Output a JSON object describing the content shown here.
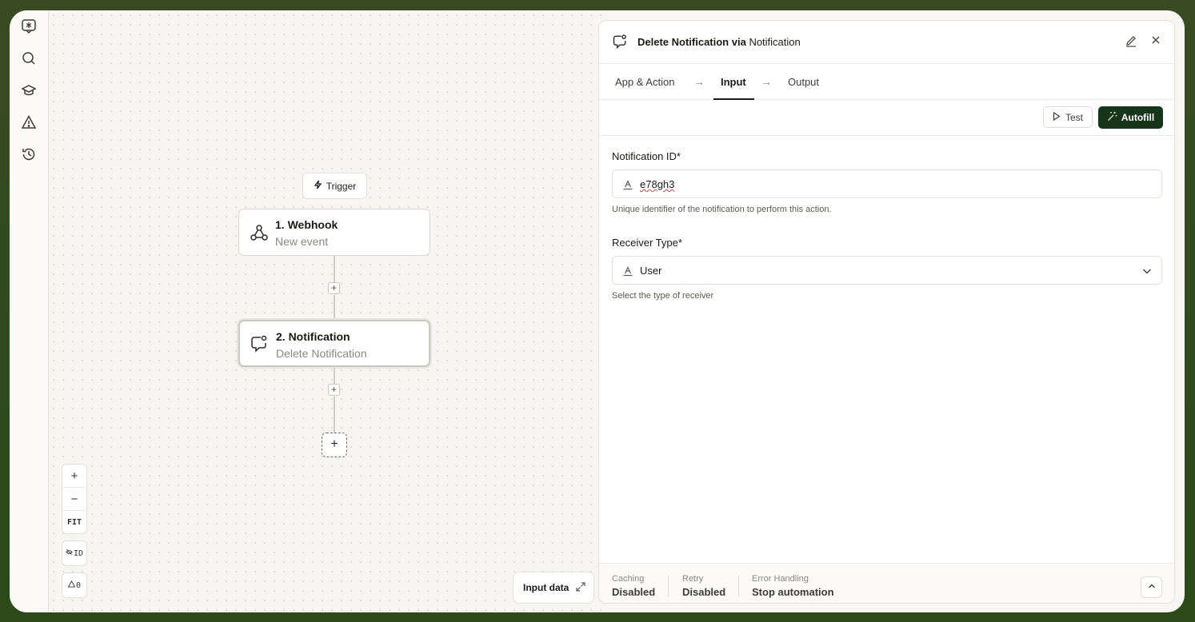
{
  "sidebar": {
    "icons": [
      "ai-chat-icon",
      "search-icon",
      "learn-icon",
      "alert-icon",
      "history-icon"
    ]
  },
  "canvas": {
    "trigger_label": "Trigger",
    "nodes": [
      {
        "title": "1. Webhook",
        "subtitle": "New event",
        "icon": "webhook-icon"
      },
      {
        "title": "2. Notification",
        "subtitle": "Delete Notification",
        "icon": "notification-icon"
      }
    ],
    "zoom": {
      "in": "+",
      "out": "−",
      "fit": "FIT"
    },
    "id_toggle": "ID",
    "warnings_count": "0",
    "input_data_label": "Input data"
  },
  "panel": {
    "title_action": "Delete Notification via",
    "title_app": "Notification",
    "tabs": [
      {
        "label": "App & Action",
        "active": false
      },
      {
        "label": "Input",
        "active": true
      },
      {
        "label": "Output",
        "active": false
      }
    ],
    "test_label": "Test",
    "autofill_label": "Autofill",
    "fields": [
      {
        "label": "Notification ID*",
        "value": "e78gh3",
        "help": "Unique identifier of the notification to perform this action."
      },
      {
        "label": "Receiver Type*",
        "value": "User",
        "help": "Select the type of receiver"
      }
    ],
    "footer": [
      {
        "label": "Caching",
        "value": "Disabled"
      },
      {
        "label": "Retry",
        "value": "Disabled"
      },
      {
        "label": "Error Handling",
        "value": "Stop automation"
      }
    ]
  },
  "colors": {
    "accent": "#17351a",
    "frame_bg": "#2f4a1d"
  }
}
